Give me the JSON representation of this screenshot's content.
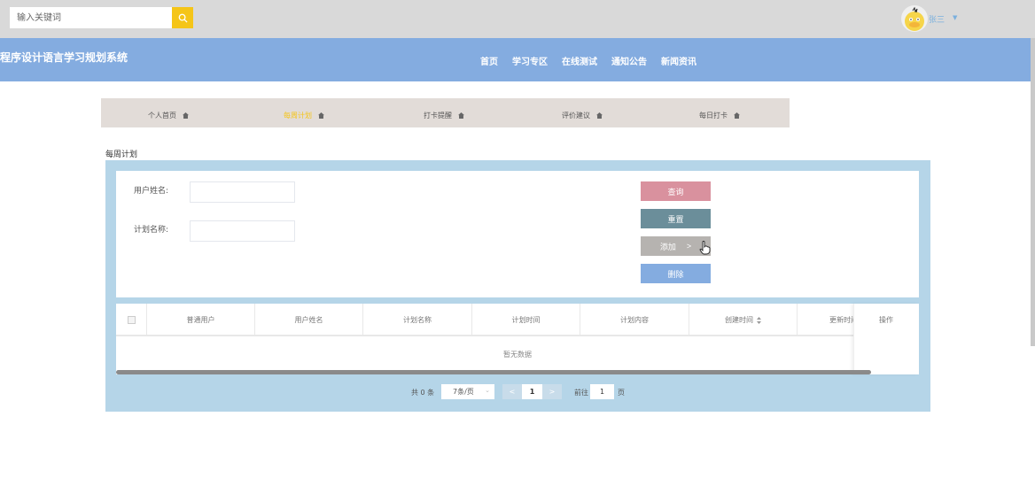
{
  "search": {
    "placeholder": "输入关键词",
    "icon": "search-icon"
  },
  "user": {
    "name": "张三",
    "avatar_icon": "duck-avatar-icon"
  },
  "header": {
    "title": "程序设计语言学习规划系统",
    "nav": [
      "首页",
      "学习专区",
      "在线测试",
      "通知公告",
      "新闻资讯"
    ]
  },
  "subnav": {
    "items": [
      {
        "label": "个人首页",
        "active": false
      },
      {
        "label": "每周计划",
        "active": true
      },
      {
        "label": "打卡提醒",
        "active": false
      },
      {
        "label": "评价建议",
        "active": false
      },
      {
        "label": "每日打卡",
        "active": false
      }
    ],
    "icon": "home-icon"
  },
  "breadcrumb": "每周计划",
  "filters": {
    "username_label": "用户姓名:",
    "planname_label": "计划名称:",
    "username_value": "",
    "planname_value": ""
  },
  "buttons": {
    "query": "查询",
    "reset": "重置",
    "add": "添加",
    "add_arrow": ">",
    "delete": "删除"
  },
  "table": {
    "columns": [
      "普通用户",
      "用户姓名",
      "计划名称",
      "计划时间",
      "计划内容",
      "创建时间",
      "更新时间",
      "操作"
    ],
    "sort_icon": "sort-icon",
    "empty_text": "暂无数据",
    "rows": []
  },
  "pagination": {
    "total": "共 0 条",
    "page_size": "7条/页",
    "current_page": "1",
    "prev": "<",
    "next": ">",
    "goto_label": "前往",
    "goto_value": "1",
    "page_suffix": "页"
  },
  "colors": {
    "topbar": "#d9d9d9",
    "header": "#84ace0",
    "accent_yellow": "#f5c518",
    "panel": "#b5d5e8",
    "query_btn": "#d9919e",
    "reset_btn": "#6b8e9a",
    "add_btn": "#b6b3b0",
    "delete_btn": "#84ace0"
  }
}
